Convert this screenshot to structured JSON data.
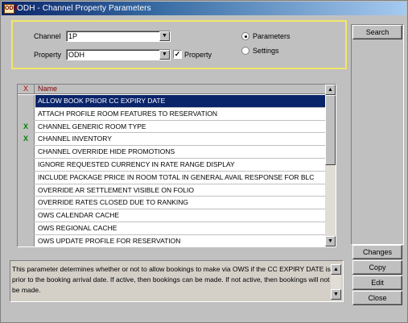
{
  "window": {
    "title": "ODH - Channel Property Parameters",
    "icon_text": "ODH"
  },
  "filter": {
    "channel_label": "Channel",
    "channel_value": "1P",
    "property_label": "Property",
    "property_value": "ODH",
    "property_checkbox_label": "Property",
    "property_checked": true,
    "radio_parameters_label": "Parameters",
    "radio_settings_label": "Settings",
    "selected_radio": "Parameters"
  },
  "buttons": {
    "search": "Search",
    "changes": "Changes",
    "copy": "Copy",
    "edit": "Edit",
    "close": "Close"
  },
  "grid": {
    "columns": [
      "X",
      "Name"
    ],
    "rows": [
      {
        "x": "",
        "name": "ALLOW BOOK PRIOR CC EXPIRY DATE",
        "selected": true
      },
      {
        "x": "",
        "name": "ATTACH PROFILE ROOM FEATURES TO RESERVATION"
      },
      {
        "x": "X",
        "name": "CHANNEL GENERIC ROOM TYPE"
      },
      {
        "x": "X",
        "name": "CHANNEL INVENTORY"
      },
      {
        "x": "",
        "name": "CHANNEL OVERRIDE HIDE PROMOTIONS"
      },
      {
        "x": "",
        "name": "IGNORE REQUESTED CURRENCY IN RATE RANGE DISPLAY"
      },
      {
        "x": "",
        "name": "INCLUDE PACKAGE PRICE IN ROOM TOTAL IN GENERAL AVAIL RESPONSE FOR BLC"
      },
      {
        "x": "",
        "name": "OVERRIDE AR SETTLEMENT VISIBLE ON FOLIO"
      },
      {
        "x": "",
        "name": "OVERRIDE RATES CLOSED DUE TO RANKING"
      },
      {
        "x": "",
        "name": "OWS CALENDAR CACHE"
      },
      {
        "x": "",
        "name": "OWS REGIONAL CACHE"
      },
      {
        "x": "",
        "name": "OWS UPDATE PROFILE FOR RESERVATION"
      }
    ]
  },
  "description": "This parameter determines whether or not to allow bookings to make via OWS if the CC EXPIRY DATE is prior to the booking arrival date. If active, then bookings can be made. If not active, then bookings will not be made.",
  "colors": {
    "selection": "#0a246a",
    "check_mark": "#008000",
    "filter_border": "#f2e66a"
  }
}
